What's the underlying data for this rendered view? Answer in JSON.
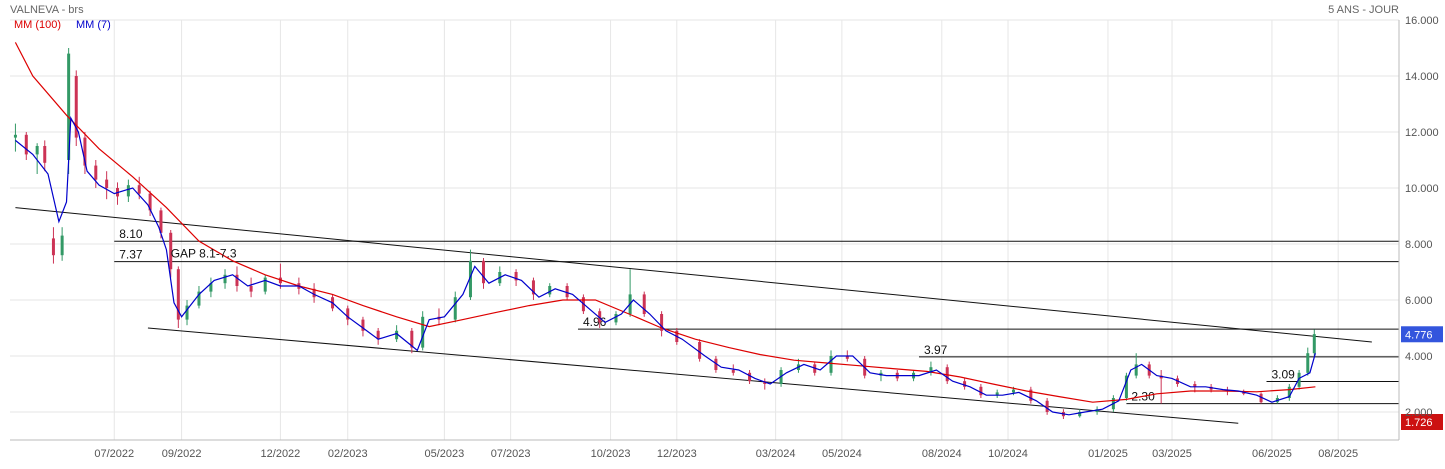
{
  "header": {
    "instrument": "VALNEVA - brs",
    "period": "5 ANS - JOUR"
  },
  "chart_data": {
    "type": "line",
    "title": "VALNEVA - brs",
    "period_label": "5 ANS - JOUR",
    "x_ticks": [
      "07/2022",
      "09/2022",
      "12/2022",
      "02/2023",
      "05/2023",
      "07/2023",
      "10/2023",
      "12/2023",
      "03/2024",
      "05/2024",
      "08/2024",
      "10/2024",
      "01/2025",
      "03/2025",
      "06/2025",
      "08/2025"
    ],
    "y_ticks": [
      "2.000",
      "4.000",
      "6.000",
      "8.000",
      "10.000",
      "12.000",
      "14.000",
      "16.000"
    ],
    "ylim": [
      1.0,
      16.0
    ],
    "grid": true,
    "legend_position": "top-left",
    "last_price": "4.776",
    "low_marker": "1.726",
    "colors": {
      "ma100": "#dd0000",
      "ma7": "#0000cc",
      "up": "#339966",
      "down": "#cc3355",
      "last": "#3355dd",
      "low": "#cc1111"
    },
    "series": [
      {
        "name": "MM (100)",
        "color": "#dd0000",
        "points": [
          [
            "2022-04-15",
            15.2
          ],
          [
            "2022-05-01",
            14.0
          ],
          [
            "2022-06-01",
            12.6
          ],
          [
            "2022-07-01",
            11.4
          ],
          [
            "2022-08-01",
            10.4
          ],
          [
            "2022-09-01",
            9.3
          ],
          [
            "2022-10-01",
            8.1
          ],
          [
            "2022-11-01",
            7.4
          ],
          [
            "2022-12-01",
            6.9
          ],
          [
            "2023-01-01",
            6.5
          ],
          [
            "2023-02-01",
            6.2
          ],
          [
            "2023-03-01",
            5.8
          ],
          [
            "2023-04-01",
            5.4
          ],
          [
            "2023-05-01",
            5.05
          ],
          [
            "2023-06-01",
            5.3
          ],
          [
            "2023-07-01",
            5.55
          ],
          [
            "2023-08-01",
            5.8
          ],
          [
            "2023-09-01",
            6.0
          ],
          [
            "2023-10-01",
            6.0
          ],
          [
            "2023-11-01",
            5.5
          ],
          [
            "2023-12-01",
            5.0
          ],
          [
            "2024-01-01",
            4.6
          ],
          [
            "2024-02-01",
            4.3
          ],
          [
            "2024-03-01",
            4.05
          ],
          [
            "2024-04-01",
            3.85
          ],
          [
            "2024-05-01",
            3.75
          ],
          [
            "2024-06-01",
            3.65
          ],
          [
            "2024-07-01",
            3.55
          ],
          [
            "2024-08-01",
            3.45
          ],
          [
            "2024-09-01",
            3.25
          ],
          [
            "2024-10-01",
            3.0
          ],
          [
            "2024-11-01",
            2.75
          ],
          [
            "2024-12-01",
            2.55
          ],
          [
            "2025-01-01",
            2.35
          ],
          [
            "2025-02-01",
            2.45
          ],
          [
            "2025-03-01",
            2.65
          ],
          [
            "2025-04-01",
            2.75
          ],
          [
            "2025-05-01",
            2.75
          ],
          [
            "2025-06-01",
            2.72
          ],
          [
            "2025-07-01",
            2.8
          ],
          [
            "2025-07-25",
            2.9
          ]
        ]
      },
      {
        "name": "MM (7)",
        "color": "#0000cc",
        "points": [
          [
            "2022-04-15",
            11.7
          ],
          [
            "2022-05-01",
            11.2
          ],
          [
            "2022-05-15",
            10.5
          ],
          [
            "2022-05-25",
            8.8
          ],
          [
            "2022-06-01",
            9.5
          ],
          [
            "2022-06-05",
            12.5
          ],
          [
            "2022-06-12",
            12.0
          ],
          [
            "2022-06-20",
            10.6
          ],
          [
            "2022-07-01",
            10.1
          ],
          [
            "2022-07-15",
            9.8
          ],
          [
            "2022-08-01",
            10.0
          ],
          [
            "2022-08-15",
            9.4
          ],
          [
            "2022-08-25",
            8.6
          ],
          [
            "2022-09-01",
            7.8
          ],
          [
            "2022-09-08",
            5.9
          ],
          [
            "2022-09-15",
            5.4
          ],
          [
            "2022-10-01",
            6.2
          ],
          [
            "2022-10-15",
            6.7
          ],
          [
            "2022-11-01",
            6.9
          ],
          [
            "2022-11-15",
            6.5
          ],
          [
            "2022-12-01",
            6.7
          ],
          [
            "2022-12-15",
            6.5
          ],
          [
            "2023-01-01",
            6.5
          ],
          [
            "2023-01-15",
            6.2
          ],
          [
            "2023-02-01",
            5.9
          ],
          [
            "2023-02-15",
            5.4
          ],
          [
            "2023-03-01",
            5.0
          ],
          [
            "2023-03-15",
            4.6
          ],
          [
            "2023-04-01",
            4.8
          ],
          [
            "2023-04-20",
            4.2
          ],
          [
            "2023-05-01",
            5.3
          ],
          [
            "2023-05-15",
            5.4
          ],
          [
            "2023-06-01",
            6.2
          ],
          [
            "2023-06-12",
            7.2
          ],
          [
            "2023-06-25",
            6.6
          ],
          [
            "2023-07-10",
            6.9
          ],
          [
            "2023-07-25",
            6.7
          ],
          [
            "2023-08-10",
            6.1
          ],
          [
            "2023-08-25",
            6.4
          ],
          [
            "2023-09-10",
            6.2
          ],
          [
            "2023-09-25",
            5.7
          ],
          [
            "2023-10-10",
            5.2
          ],
          [
            "2023-10-25",
            5.5
          ],
          [
            "2023-11-05",
            6.0
          ],
          [
            "2023-11-20",
            5.5
          ],
          [
            "2023-12-05",
            4.9
          ],
          [
            "2023-12-20",
            4.6
          ],
          [
            "2024-01-10",
            4.0
          ],
          [
            "2024-01-25",
            3.6
          ],
          [
            "2024-02-10",
            3.5
          ],
          [
            "2024-02-25",
            3.2
          ],
          [
            "2024-03-10",
            3.0
          ],
          [
            "2024-03-25",
            3.4
          ],
          [
            "2024-04-10",
            3.7
          ],
          [
            "2024-04-25",
            3.5
          ],
          [
            "2024-05-10",
            4.0
          ],
          [
            "2024-05-25",
            4.0
          ],
          [
            "2024-06-10",
            3.4
          ],
          [
            "2024-06-25",
            3.3
          ],
          [
            "2024-07-10",
            3.3
          ],
          [
            "2024-07-25",
            3.3
          ],
          [
            "2024-08-10",
            3.5
          ],
          [
            "2024-08-25",
            3.1
          ],
          [
            "2024-09-10",
            2.9
          ],
          [
            "2024-09-25",
            2.6
          ],
          [
            "2024-10-10",
            2.6
          ],
          [
            "2024-10-25",
            2.7
          ],
          [
            "2024-11-10",
            2.4
          ],
          [
            "2024-11-25",
            2.0
          ],
          [
            "2024-12-10",
            1.9
          ],
          [
            "2024-12-25",
            2.0
          ],
          [
            "2025-01-10",
            2.1
          ],
          [
            "2025-01-25",
            2.4
          ],
          [
            "2025-02-05",
            3.5
          ],
          [
            "2025-02-15",
            3.7
          ],
          [
            "2025-03-01",
            3.3
          ],
          [
            "2025-03-15",
            3.2
          ],
          [
            "2025-04-01",
            2.9
          ],
          [
            "2025-04-15",
            2.9
          ],
          [
            "2025-05-01",
            2.8
          ],
          [
            "2025-05-15",
            2.75
          ],
          [
            "2025-06-01",
            2.6
          ],
          [
            "2025-06-15",
            2.35
          ],
          [
            "2025-07-01",
            2.55
          ],
          [
            "2025-07-10",
            3.2
          ],
          [
            "2025-07-20",
            3.4
          ],
          [
            "2025-07-25",
            4.1
          ]
        ]
      }
    ],
    "candles_ohlc": [
      [
        "2022-04-15",
        11.8,
        12.3,
        11.3,
        11.9
      ],
      [
        "2022-04-25",
        11.9,
        12.0,
        11.0,
        11.2
      ],
      [
        "2022-05-05",
        11.2,
        11.6,
        10.5,
        11.5
      ],
      [
        "2022-05-12",
        11.5,
        11.7,
        10.6,
        10.9
      ],
      [
        "2022-05-20",
        8.2,
        8.6,
        7.3,
        7.6
      ],
      [
        "2022-05-28",
        7.6,
        8.6,
        7.4,
        8.3
      ],
      [
        "2022-06-03",
        11.0,
        15.0,
        10.5,
        14.8
      ],
      [
        "2022-06-10",
        14.0,
        14.2,
        11.5,
        11.8
      ],
      [
        "2022-06-18",
        11.8,
        12.0,
        10.5,
        10.8
      ],
      [
        "2022-06-28",
        10.8,
        11.0,
        10.0,
        10.3
      ],
      [
        "2022-07-08",
        10.3,
        10.6,
        9.6,
        10.0
      ],
      [
        "2022-07-18",
        10.0,
        10.2,
        9.4,
        9.7
      ],
      [
        "2022-07-28",
        9.7,
        10.3,
        9.5,
        10.1
      ],
      [
        "2022-08-07",
        10.1,
        10.4,
        9.6,
        9.8
      ],
      [
        "2022-08-17",
        9.8,
        9.9,
        9.0,
        9.2
      ],
      [
        "2022-08-27",
        9.2,
        9.3,
        8.2,
        8.4
      ],
      [
        "2022-09-05",
        8.4,
        8.5,
        6.8,
        7.1
      ],
      [
        "2022-09-12",
        7.1,
        7.2,
        5.0,
        5.3
      ],
      [
        "2022-09-20",
        5.3,
        6.0,
        5.1,
        5.8
      ],
      [
        "2022-10-01",
        5.8,
        6.5,
        5.7,
        6.3
      ],
      [
        "2022-10-12",
        6.3,
        6.8,
        6.1,
        6.6
      ],
      [
        "2022-10-25",
        6.6,
        7.1,
        6.4,
        6.9
      ],
      [
        "2022-11-05",
        6.9,
        7.2,
        6.3,
        6.5
      ],
      [
        "2022-11-18",
        6.5,
        6.8,
        6.1,
        6.3
      ],
      [
        "2022-12-01",
        6.3,
        6.9,
        6.2,
        6.8
      ],
      [
        "2022-12-15",
        6.8,
        7.3,
        6.4,
        6.6
      ],
      [
        "2023-01-01",
        6.6,
        6.8,
        6.2,
        6.4
      ],
      [
        "2023-01-15",
        6.4,
        6.6,
        5.9,
        6.1
      ],
      [
        "2023-02-01",
        6.1,
        6.2,
        5.6,
        5.7
      ],
      [
        "2023-02-15",
        5.7,
        5.8,
        5.1,
        5.3
      ],
      [
        "2023-03-01",
        5.3,
        5.4,
        4.7,
        4.9
      ],
      [
        "2023-03-15",
        4.9,
        5.0,
        4.4,
        4.6
      ],
      [
        "2023-04-01",
        4.6,
        5.1,
        4.5,
        4.9
      ],
      [
        "2023-04-15",
        4.9,
        5.0,
        4.1,
        4.3
      ],
      [
        "2023-04-25",
        4.3,
        5.6,
        4.2,
        5.4
      ],
      [
        "2023-05-10",
        5.4,
        5.7,
        5.1,
        5.3
      ],
      [
        "2023-05-25",
        5.3,
        6.3,
        5.2,
        6.1
      ],
      [
        "2023-06-08",
        6.1,
        7.8,
        6.0,
        7.4
      ],
      [
        "2023-06-20",
        7.4,
        7.5,
        6.4,
        6.6
      ],
      [
        "2023-07-05",
        6.6,
        7.2,
        6.5,
        7.0
      ],
      [
        "2023-07-20",
        7.0,
        7.1,
        6.5,
        6.7
      ],
      [
        "2023-08-05",
        6.7,
        6.8,
        6.0,
        6.2
      ],
      [
        "2023-08-20",
        6.2,
        6.6,
        6.1,
        6.5
      ],
      [
        "2023-09-05",
        6.5,
        6.6,
        6.0,
        6.1
      ],
      [
        "2023-09-20",
        6.1,
        6.2,
        5.5,
        5.6
      ],
      [
        "2023-10-05",
        5.6,
        5.7,
        5.0,
        5.2
      ],
      [
        "2023-10-20",
        5.2,
        5.6,
        5.1,
        5.5
      ],
      [
        "2023-11-02",
        5.5,
        7.1,
        5.4,
        6.2
      ],
      [
        "2023-11-15",
        6.2,
        6.3,
        5.4,
        5.5
      ],
      [
        "2023-12-01",
        5.5,
        5.6,
        4.7,
        4.9
      ],
      [
        "2023-12-15",
        4.9,
        5.0,
        4.4,
        4.5
      ],
      [
        "2024-01-05",
        4.5,
        4.6,
        3.8,
        3.9
      ],
      [
        "2024-01-20",
        3.9,
        4.0,
        3.4,
        3.5
      ],
      [
        "2024-02-05",
        3.5,
        3.7,
        3.3,
        3.4
      ],
      [
        "2024-02-20",
        3.4,
        3.5,
        3.0,
        3.1
      ],
      [
        "2024-03-05",
        3.1,
        3.2,
        2.8,
        3.0
      ],
      [
        "2024-03-20",
        3.0,
        3.6,
        2.9,
        3.5
      ],
      [
        "2024-04-05",
        3.5,
        3.9,
        3.4,
        3.7
      ],
      [
        "2024-04-20",
        3.7,
        3.8,
        3.3,
        3.4
      ],
      [
        "2024-05-05",
        3.4,
        4.2,
        3.3,
        4.0
      ],
      [
        "2024-05-20",
        4.0,
        4.2,
        3.8,
        3.9
      ],
      [
        "2024-06-05",
        3.9,
        4.0,
        3.2,
        3.3
      ],
      [
        "2024-06-20",
        3.3,
        3.5,
        3.1,
        3.4
      ],
      [
        "2024-07-05",
        3.4,
        3.5,
        3.1,
        3.2
      ],
      [
        "2024-07-20",
        3.2,
        3.5,
        3.1,
        3.4
      ],
      [
        "2024-08-05",
        3.4,
        3.8,
        3.3,
        3.6
      ],
      [
        "2024-08-20",
        3.6,
        3.7,
        3.0,
        3.1
      ],
      [
        "2024-09-05",
        3.1,
        3.2,
        2.8,
        2.9
      ],
      [
        "2024-09-20",
        2.9,
        3.0,
        2.5,
        2.6
      ],
      [
        "2024-10-05",
        2.6,
        2.8,
        2.5,
        2.7
      ],
      [
        "2024-10-20",
        2.7,
        2.9,
        2.6,
        2.8
      ],
      [
        "2024-11-05",
        2.8,
        2.9,
        2.3,
        2.4
      ],
      [
        "2024-11-20",
        2.4,
        2.5,
        1.9,
        2.0
      ],
      [
        "2024-12-05",
        2.0,
        2.1,
        1.75,
        1.85
      ],
      [
        "2024-12-20",
        1.85,
        2.1,
        1.8,
        2.0
      ],
      [
        "2025-01-05",
        2.0,
        2.2,
        1.9,
        2.1
      ],
      [
        "2025-01-20",
        2.1,
        2.6,
        2.0,
        2.5
      ],
      [
        "2025-02-01",
        2.5,
        3.4,
        2.4,
        3.3
      ],
      [
        "2025-02-10",
        3.3,
        4.1,
        3.2,
        3.7
      ],
      [
        "2025-02-22",
        3.7,
        3.8,
        3.2,
        3.3
      ],
      [
        "2025-03-05",
        3.3,
        3.5,
        2.3,
        3.2
      ],
      [
        "2025-03-20",
        3.2,
        3.3,
        2.9,
        3.0
      ],
      [
        "2025-04-05",
        3.0,
        3.1,
        2.7,
        2.9
      ],
      [
        "2025-04-20",
        2.9,
        3.0,
        2.7,
        2.8
      ],
      [
        "2025-05-05",
        2.8,
        2.9,
        2.6,
        2.75
      ],
      [
        "2025-05-20",
        2.75,
        2.8,
        2.6,
        2.65
      ],
      [
        "2025-06-05",
        2.65,
        2.7,
        2.3,
        2.35
      ],
      [
        "2025-06-20",
        2.35,
        2.6,
        2.3,
        2.5
      ],
      [
        "2025-07-01",
        2.5,
        3.0,
        2.4,
        2.9
      ],
      [
        "2025-07-10",
        2.9,
        3.5,
        2.8,
        3.4
      ],
      [
        "2025-07-18",
        3.4,
        4.3,
        3.3,
        4.1
      ],
      [
        "2025-07-24",
        4.1,
        4.95,
        4.0,
        4.78
      ]
    ],
    "levels": [
      {
        "label": "8.10",
        "value": 8.1
      },
      {
        "label": "7.37",
        "value": 7.37
      },
      {
        "label": "4.96",
        "value": 4.96
      },
      {
        "label": "3.97",
        "value": 3.97
      },
      {
        "label": "3.09",
        "value": 3.09
      },
      {
        "label": "2.30",
        "value": 2.3
      }
    ],
    "annotations": [
      {
        "text": "GAP 8.1-7.3",
        "x": "2022-09-05",
        "y": 7.37
      }
    ],
    "trendlines": [
      {
        "from": [
          "2022-04-15",
          9.3
        ],
        "to": [
          "2025-09-15",
          4.5
        ]
      },
      {
        "from": [
          "2022-08-15",
          5.0
        ],
        "to": [
          "2025-05-15",
          1.6
        ]
      }
    ]
  }
}
